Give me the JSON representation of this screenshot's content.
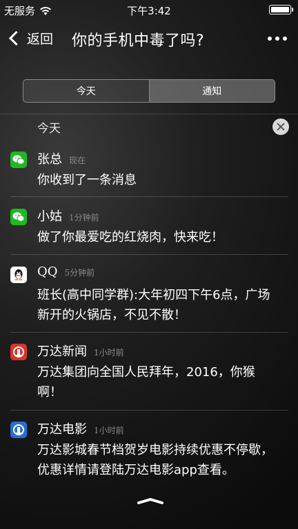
{
  "status_bar": {
    "carrier": "无服务",
    "time": "下午3:42"
  },
  "nav": {
    "back_label": "返回",
    "title": "你的手机中毒了吗?"
  },
  "segments": {
    "today": "今天",
    "notifications": "通知"
  },
  "section": {
    "title": "今天"
  },
  "notifications": [
    {
      "app": "wechat",
      "name": "张总",
      "time": "现在",
      "body": "你收到了一条消息"
    },
    {
      "app": "wechat",
      "name": "小姑",
      "time": "1分钟前",
      "body": "做了你最爱吃的红烧肉，快来吃！"
    },
    {
      "app": "qq",
      "name": "QQ",
      "time": "5分钟前",
      "body": "班长(高中同学群):大年初四下午6点，广场新开的火锅店，不见不散！"
    },
    {
      "app": "wanda-news",
      "name": "万达新闻",
      "time": "1小时前",
      "body": "万达集团向全国人民拜年，2016，你猴啊！"
    },
    {
      "app": "wanda-movie",
      "name": "万达电影",
      "time": "1小时前",
      "body": "万达影城春节档贺岁电影持续优惠不停歇，优惠详情请登陆万达电影app查看。"
    }
  ],
  "colors": {
    "wechat": "#1fb922",
    "wanda_news": "#d8352a",
    "wanda_movie": "#2a6ed4"
  }
}
